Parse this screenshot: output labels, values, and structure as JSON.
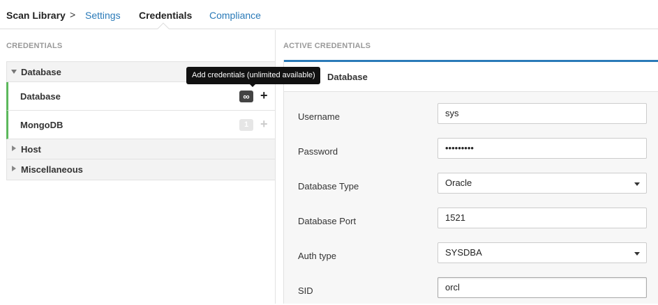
{
  "nav": {
    "root": "Scan Library",
    "chevron": ">",
    "tabs": [
      {
        "label": "Settings"
      },
      {
        "label": "Credentials"
      },
      {
        "label": "Compliance"
      }
    ]
  },
  "left": {
    "section_title": "CREDENTIALS",
    "groups": {
      "database": {
        "label": "Database",
        "items": [
          {
            "label": "Database",
            "badge": "∞",
            "add": "+"
          },
          {
            "label": "MongoDB",
            "badge": "1",
            "add": "+"
          }
        ]
      },
      "host": {
        "label": "Host"
      },
      "misc": {
        "label": "Miscellaneous"
      }
    },
    "tooltip": "Add credentials (unlimited available)"
  },
  "right": {
    "section_title": "ACTIVE CREDENTIALS",
    "cred_title": "Database",
    "fields": {
      "username": {
        "label": "Username",
        "value": "sys"
      },
      "password": {
        "label": "Password",
        "value": "•••••••••"
      },
      "db_type": {
        "label": "Database Type",
        "value": "Oracle"
      },
      "db_port": {
        "label": "Database Port",
        "value": "1521"
      },
      "auth_type": {
        "label": "Auth type",
        "value": "SYSDBA"
      },
      "sid": {
        "label": "SID",
        "value": "orcl"
      }
    }
  },
  "colors": {
    "accent": "#2a7ab8",
    "active_marker": "#5cb85c"
  }
}
